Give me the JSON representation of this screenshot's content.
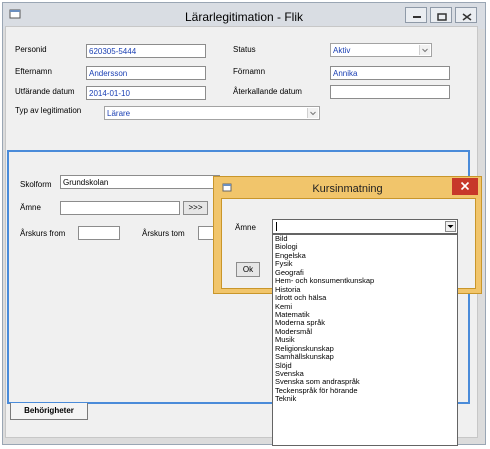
{
  "window": {
    "title": "Lärarlegitimation - Flik",
    "minimize": "–",
    "maximize": "▭",
    "close": "✕"
  },
  "form": {
    "personid_label": "Personid",
    "personid_value": "620305-5444",
    "efternamn_label": "Efternamn",
    "efternamn_value": "Andersson",
    "utfardande_label": "Utfärande datum",
    "utfardande_value": "2014-01-10",
    "typ_label": "Typ av legitimation",
    "typ_value": "Lärare",
    "status_label": "Status",
    "status_value": "Aktiv",
    "fornamn_label": "Förnamn",
    "fornamn_value": "Annika",
    "aterkallande_label": "Återkallande datum",
    "aterkallande_value": ""
  },
  "panel": {
    "skolform_label": "Skolform",
    "skolform_value": "Grundskolan",
    "amne_label": "Ämne",
    "amne_value": "",
    "amne_button": ">>>",
    "arskurs_from_label": "Årskurs from",
    "arskurs_tom_label": "Årskurs tom"
  },
  "tabs": {
    "behorigheter": "Behörigheter"
  },
  "dialog": {
    "title": "Kursinmatning",
    "close": "✕",
    "amne_label": "Ämne",
    "ok_button": "Ok",
    "options": [
      "Bild",
      "Biologi",
      "Engelska",
      "Fysik",
      "Geografi",
      "Hem- och konsumentkunskap",
      "Historia",
      "Idrott och hälsa",
      "Kemi",
      "Matematik",
      "Moderna språk",
      "Modersmål",
      "Musik",
      "Religionskunskap",
      "Samhällskunskap",
      "Slöjd",
      "Svenska",
      "Svenska som andraspråk",
      "Teckenspråk för hörande",
      "Teknik"
    ]
  },
  "colors": {
    "accent": "#4a8bd9",
    "dialog_frame": "#f1c56b",
    "close_red": "#c7382a",
    "value_text": "#1a3fb3"
  }
}
